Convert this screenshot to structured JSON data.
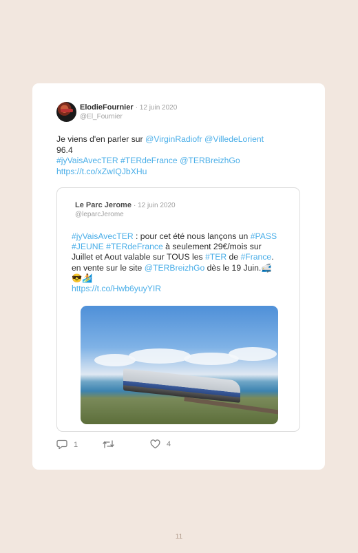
{
  "tweet": {
    "author_name": "ElodieFournier",
    "date": "12 juin 2020",
    "handle": "@El_Fournier",
    "text_plain_1": "Je viens d'en parler sur ",
    "mention_1": "@VirginRadiofr",
    "mention_2": "@VilledeLorient",
    "text_plain_2": "96.4",
    "hashtag_1": "#jyVaisAvecTER",
    "hashtag_2": "#TERdeFrance",
    "mention_3": "@TERBreizhGo",
    "link": "https://t.co/xZwIQJbXHu",
    "replies": "1",
    "likes": "4"
  },
  "quoted": {
    "author_name": "Le Parc Jerome",
    "date": "12 juin 2020",
    "handle": "@leparcJerome",
    "hashtag_1": "#jyVaisAvecTER",
    "t1": " : pour cet été nous lançons un ",
    "hashtag_2": "#PASS",
    "hashtag_3": "#JEUNE",
    "hashtag_4": "#TERdeFrance",
    "t2": " à seulement 29€/mois sur Juillet et Aout valable sur TOUS les ",
    "hashtag_5": "#TER",
    "t3": " de ",
    "hashtag_6": "#France",
    "t4": ". en vente sur le site ",
    "mention_1": "@TERBreizhGo",
    "t5": " dès le 19 Juin.🚅😎🏄",
    "link": "https://t.co/Hwb6yuyYIR"
  },
  "icons": {
    "reply": "speech-bubble-icon",
    "retweet": "retweet-icon",
    "like": "heart-icon"
  },
  "colors": {
    "link": "#4aaee8",
    "background": "#f2e7df"
  },
  "page_number": "11"
}
